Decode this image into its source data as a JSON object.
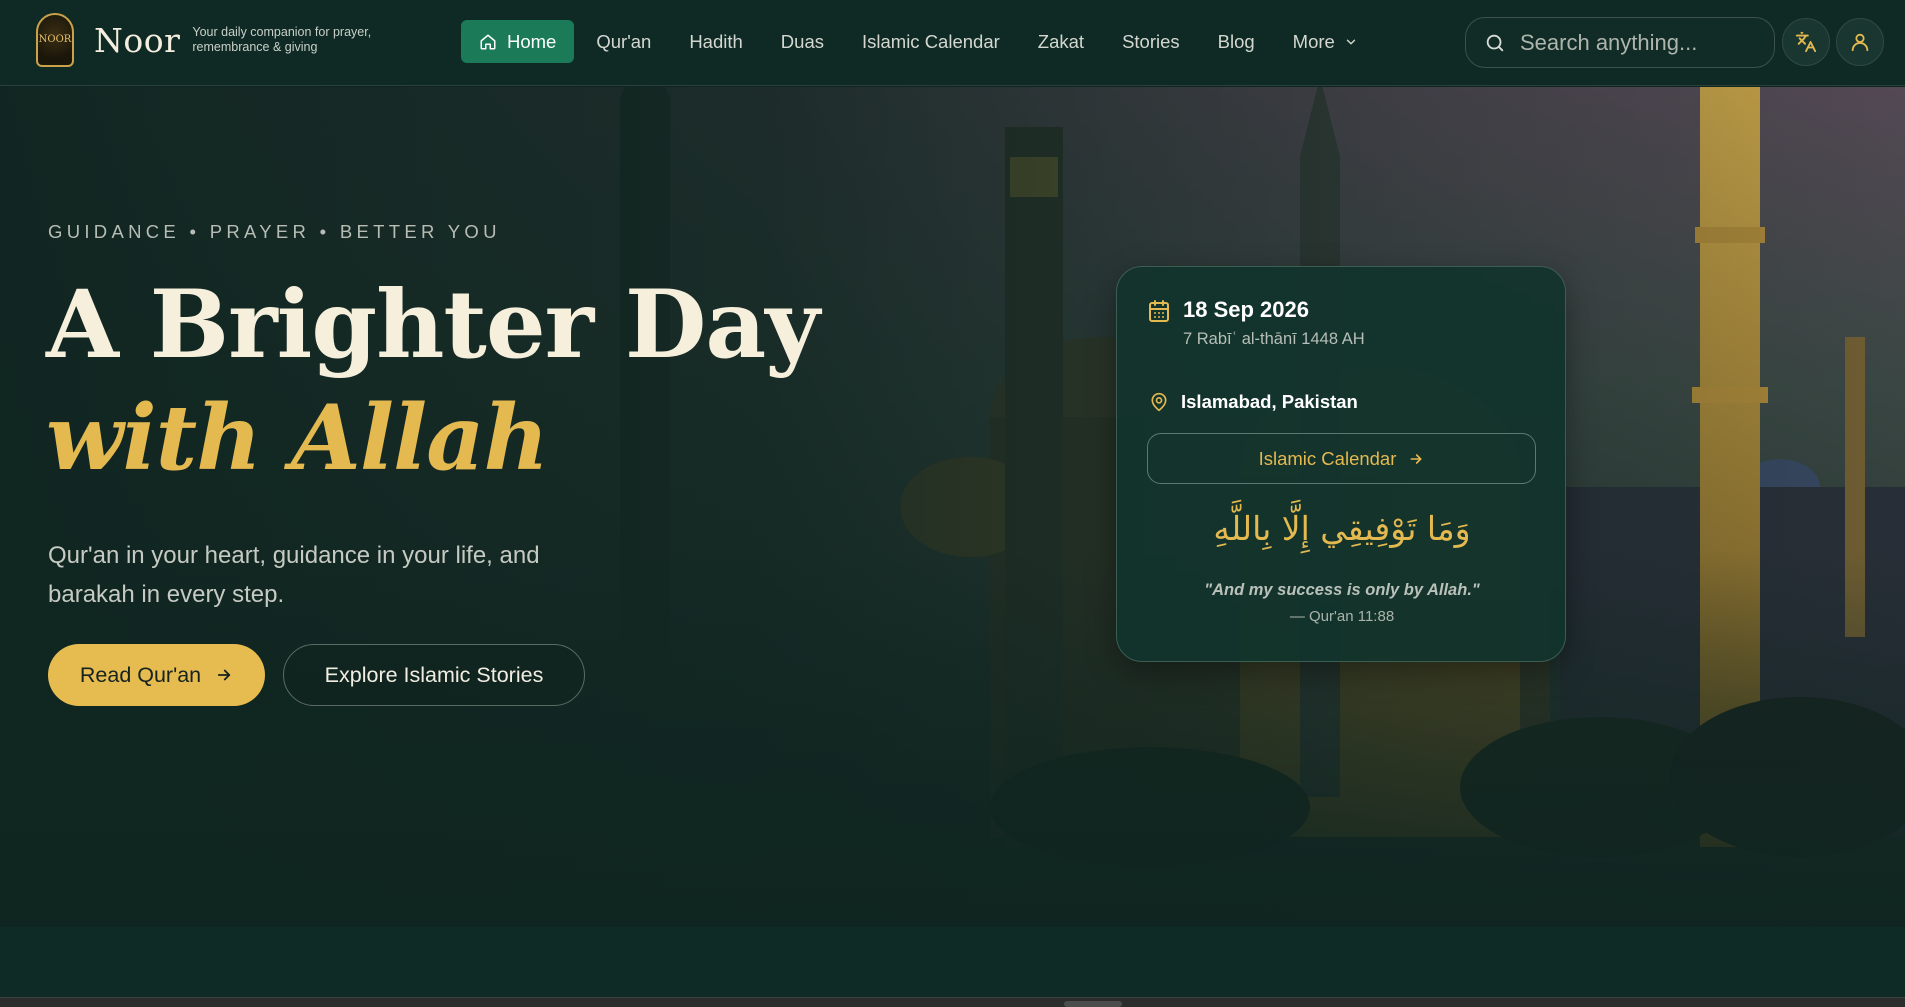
{
  "brand": {
    "logo_text": "NOOR",
    "name": "Noor",
    "tagline": "Your daily companion for prayer, remembrance & giving"
  },
  "nav": {
    "items": [
      {
        "label": "Home",
        "active": true,
        "icon": "home-icon"
      },
      {
        "label": "Qur'an"
      },
      {
        "label": "Hadith"
      },
      {
        "label": "Duas"
      },
      {
        "label": "Islamic Calendar"
      },
      {
        "label": "Zakat"
      },
      {
        "label": "Stories"
      },
      {
        "label": "Blog"
      },
      {
        "label": "More",
        "icon": "chevron-down-icon"
      }
    ]
  },
  "search": {
    "placeholder": "Search anything...",
    "icon": "search-icon"
  },
  "header_actions": {
    "language_icon": "translate-icon",
    "account_icon": "user-icon"
  },
  "hero": {
    "eyebrow": "GUIDANCE • PRAYER • BETTER YOU",
    "headline_line1": "A Brighter Day",
    "headline_line2": "with Allah",
    "subtext": "Qur'an in your heart, guidance in your life, and barakah in every step.",
    "primary_cta": "Read Qur'an",
    "secondary_cta": "Explore Islamic Stories"
  },
  "date_card": {
    "gregorian_date": "18 Sep 2026",
    "hijri_date": "7 Rabīʿ al-thānī 1448 AH",
    "location": "Islamabad, Pakistan",
    "calendar_button": "Islamic Calendar",
    "arabic_verse": "وَمَا تَوْفِيقِي إِلَّا بِاللَّهِ",
    "translation": "\"And my success is only by Allah.\"",
    "reference": "— Qur'an 11:88"
  },
  "colors": {
    "accent_gold": "#e4b950",
    "active_nav_green": "#1b7a58",
    "background": "#0f2a24"
  }
}
